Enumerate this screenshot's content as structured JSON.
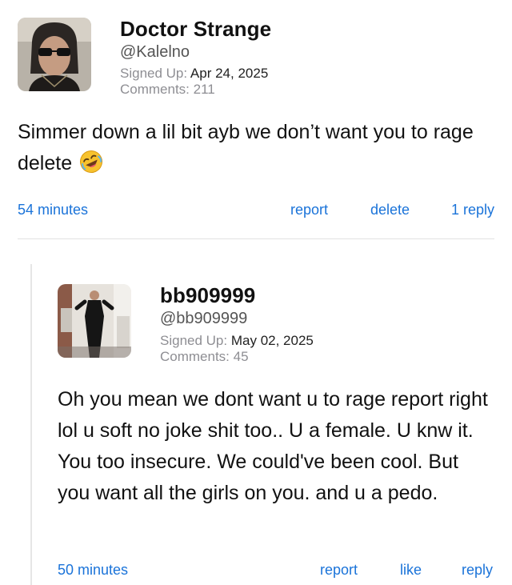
{
  "comment": {
    "author_name": "Doctor Strange",
    "handle": "@Kalelno",
    "signed_up_label": "Signed Up:",
    "signed_up_date": "Apr 24, 2025",
    "comments_label": "Comments:",
    "comments_count": "211",
    "text": "Simmer down a lil bit ayb we don’t want you to rage delete",
    "emoji": "rolling-on-floor-laughing",
    "time": "54 minutes",
    "actions": {
      "report": "report",
      "delete": "delete",
      "replies": "1 reply"
    }
  },
  "reply": {
    "author_name": "bb909999",
    "handle": "@bb909999",
    "signed_up_label": "Signed Up:",
    "signed_up_date": "May 02, 2025",
    "comments_label": "Comments:",
    "comments_count": "45",
    "text": "Oh you mean we dont want u to rage report right lol u soft no joke shit too.. U a female. U knw it. You too insecure. We could've been cool. But you want all the girls on you. and u a pedo.",
    "time": "50 minutes",
    "actions": {
      "report": "report",
      "like": "like",
      "reply": "reply"
    }
  },
  "colors": {
    "link": "#1a73d9",
    "meta_gray": "#8e8e93",
    "divider": "#e2e2e2"
  }
}
